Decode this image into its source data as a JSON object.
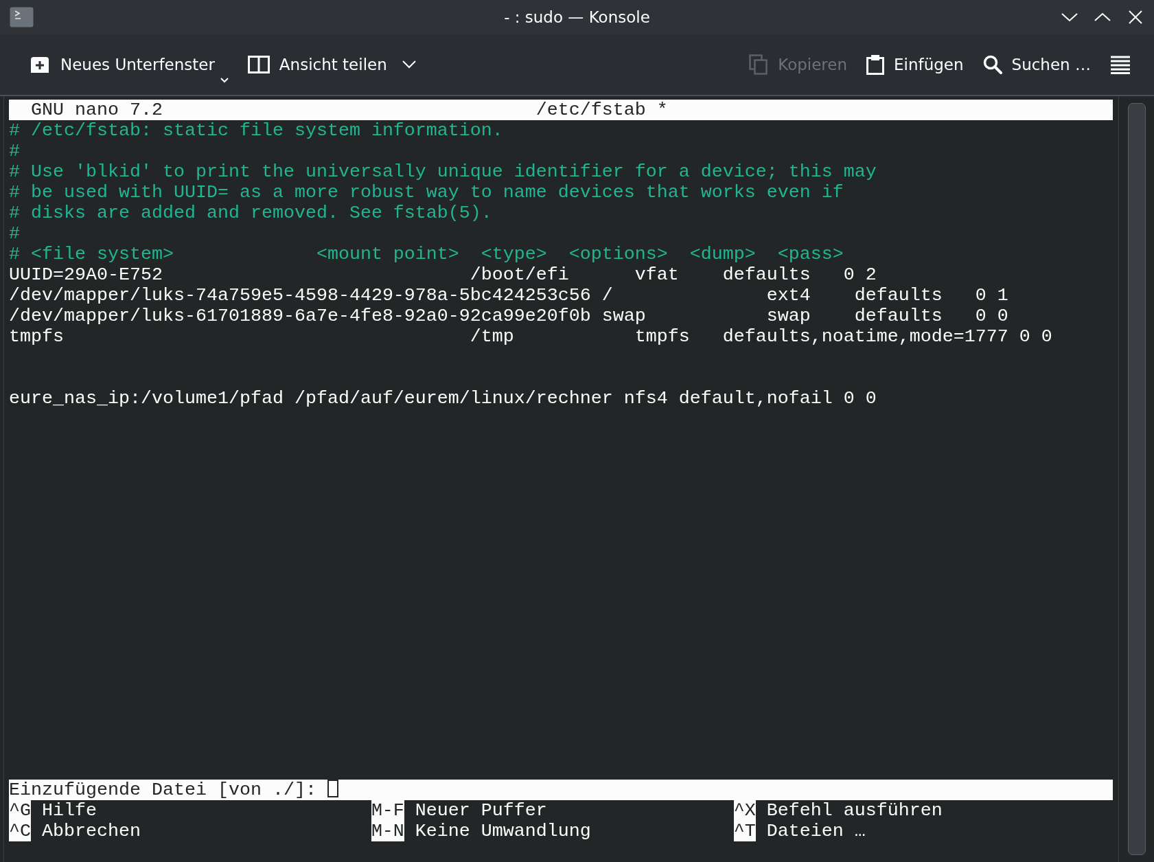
{
  "window": {
    "title": "- : sudo — Konsole"
  },
  "toolbar": {
    "left": [
      {
        "kind": "new_tab",
        "label": "Neues Unterfenster",
        "disabled": false
      },
      {
        "kind": "split_view",
        "label": "Ansicht teilen",
        "disabled": false
      }
    ],
    "right": [
      {
        "kind": "copy",
        "label": "Kopieren",
        "disabled": true
      },
      {
        "kind": "paste",
        "label": "Einfügen",
        "disabled": false
      },
      {
        "kind": "find",
        "label": "Suchen …",
        "disabled": false
      },
      {
        "kind": "menu",
        "disabled": false
      }
    ]
  },
  "editor": {
    "app": "GNU nano 7.2",
    "file": "/etc/fstab *",
    "lines": [
      {
        "kind": "comment",
        "text": "# /etc/fstab: static file system information."
      },
      {
        "kind": "comment",
        "text": "#"
      },
      {
        "kind": "comment",
        "text": "# Use 'blkid' to print the universally unique identifier for a device; this may"
      },
      {
        "kind": "comment",
        "text": "# be used with UUID= as a more robust way to name devices that works even if"
      },
      {
        "kind": "comment",
        "text": "# disks are added and removed. See fstab(5)."
      },
      {
        "kind": "comment",
        "text": "#"
      },
      {
        "kind": "comment",
        "text": "# <file system>             <mount point>  <type>  <options>  <dump>  <pass>"
      },
      {
        "kind": "code",
        "text": "UUID=29A0-E752                            /boot/efi      vfat    defaults   0 2"
      },
      {
        "kind": "code",
        "text": "/dev/mapper/luks-74a759e5-4598-4429-978a-5bc424253c56 /              ext4    defaults   0 1"
      },
      {
        "kind": "code",
        "text": "/dev/mapper/luks-61701889-6a7e-4fe8-92a0-92ca99e20f0b swap           swap    defaults   0 0"
      },
      {
        "kind": "code",
        "text": "tmpfs                                     /tmp           tmpfs   defaults,noatime,mode=1777 0 0"
      },
      {
        "kind": "blank"
      },
      {
        "kind": "blank"
      },
      {
        "kind": "code",
        "text": "eure_nas_ip:/volume1/pfad /pfad/auf/eurem/linux/rechner nfs4 default,nofail 0 0"
      }
    ],
    "prompt": {
      "label": "Einzufügende Datei [von ./]:"
    },
    "shortcuts": [
      [
        {
          "key": "^G",
          "label": "Hilfe"
        },
        {
          "key": "M-F",
          "label": "Neuer Puffer"
        },
        {
          "key": "^X",
          "label": "Befehl ausführen"
        }
      ],
      [
        {
          "key": "^C",
          "label": "Abbrechen"
        },
        {
          "key": "M-N",
          "label": "Keine Umwandlung"
        },
        {
          "key": "^T",
          "label": "Dateien …"
        }
      ]
    ]
  }
}
